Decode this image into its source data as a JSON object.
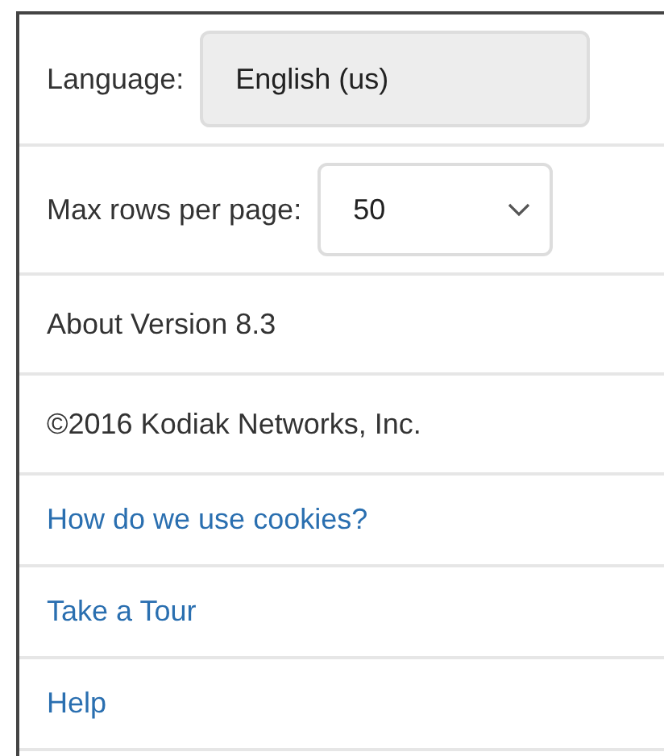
{
  "rows": [
    {
      "kind": "field",
      "label": "Language:",
      "value": "English (us)",
      "disabled": true
    },
    {
      "kind": "select",
      "label": "Max rows per page:",
      "value": "50"
    },
    {
      "kind": "text",
      "text": "About Version 8.3"
    },
    {
      "kind": "text",
      "text": "©2016 Kodiak Networks, Inc."
    },
    {
      "kind": "link",
      "text": "How do we use cookies?"
    },
    {
      "kind": "link",
      "text": "Take a Tour"
    },
    {
      "kind": "link",
      "text": "Help"
    }
  ]
}
